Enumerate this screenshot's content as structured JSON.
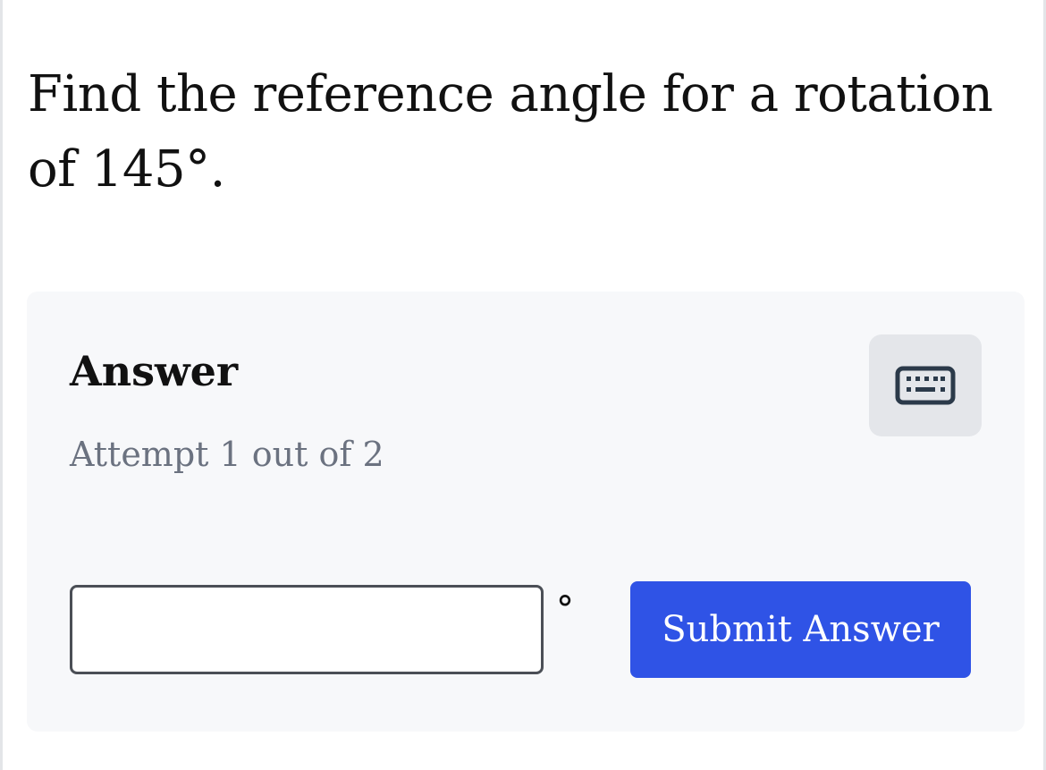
{
  "question": {
    "text": "Find the reference angle for a rotation of 145°."
  },
  "answer_panel": {
    "title": "Answer",
    "attempt_text": "Attempt 1 out of 2",
    "keyboard_button_icon": "keyboard-icon",
    "input": {
      "value": "",
      "placeholder": ""
    },
    "unit_symbol": "°",
    "submit_label": "Submit Answer"
  },
  "colors": {
    "accent": "#2f53e6",
    "panel_background": "#f7f8fa",
    "muted_text": "#6b7280",
    "keyboard_button_bg": "#e4e6ea",
    "icon_color": "#2b3a4a"
  }
}
